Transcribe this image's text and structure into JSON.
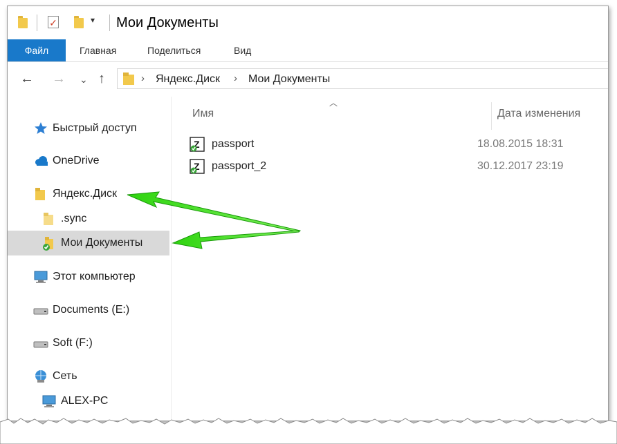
{
  "window": {
    "title": "Мои Документы"
  },
  "quick_access_toolbar": {
    "icons": [
      "folder-icon",
      "properties-check-icon",
      "new-folder-icon",
      "customize-dropdown-icon"
    ],
    "dropdown_glyph": "▾"
  },
  "ribbon": {
    "tabs": [
      {
        "label": "Файл",
        "active": true
      },
      {
        "label": "Главная"
      },
      {
        "label": "Поделиться"
      },
      {
        "label": "Вид"
      }
    ]
  },
  "navigation": {
    "back": "←",
    "forward": "→",
    "recent": "⌄",
    "up": "↑"
  },
  "address_bar": {
    "separator": "›",
    "crumbs": [
      "Яндекс.Диск",
      "Мои Документы"
    ]
  },
  "nav_pane": {
    "items": [
      {
        "label": "Быстрый доступ",
        "icon": "star-icon"
      },
      {
        "label": "OneDrive",
        "icon": "cloud-icon"
      },
      {
        "label": "Яндекс.Диск",
        "icon": "folder-icon"
      },
      {
        "label": ".sync",
        "icon": "folder-icon"
      },
      {
        "label": "Мои Документы",
        "icon": "synced-folder-icon",
        "selected": true
      },
      {
        "label": "Этот компьютер",
        "icon": "computer-icon"
      },
      {
        "label": "Documents (E:)",
        "icon": "drive-icon"
      },
      {
        "label": "Soft (F:)",
        "icon": "drive-icon"
      },
      {
        "label": "Сеть",
        "icon": "network-icon"
      },
      {
        "label": "ALEX-PC",
        "icon": "computer-icon"
      }
    ]
  },
  "file_list": {
    "sort_glyph": "︿",
    "columns": [
      "Имя",
      "Дата изменения"
    ],
    "rows": [
      {
        "name": "passport",
        "date": "18.08.2015 18:31",
        "icon": "synced-archive-icon"
      },
      {
        "name": "passport_2",
        "date": "30.12.2017 23:19",
        "icon": "synced-archive-icon"
      }
    ]
  },
  "colors": {
    "accent": "#1979ca",
    "selection": "#d9d9d9",
    "annotation_arrow": "#3de01c"
  }
}
